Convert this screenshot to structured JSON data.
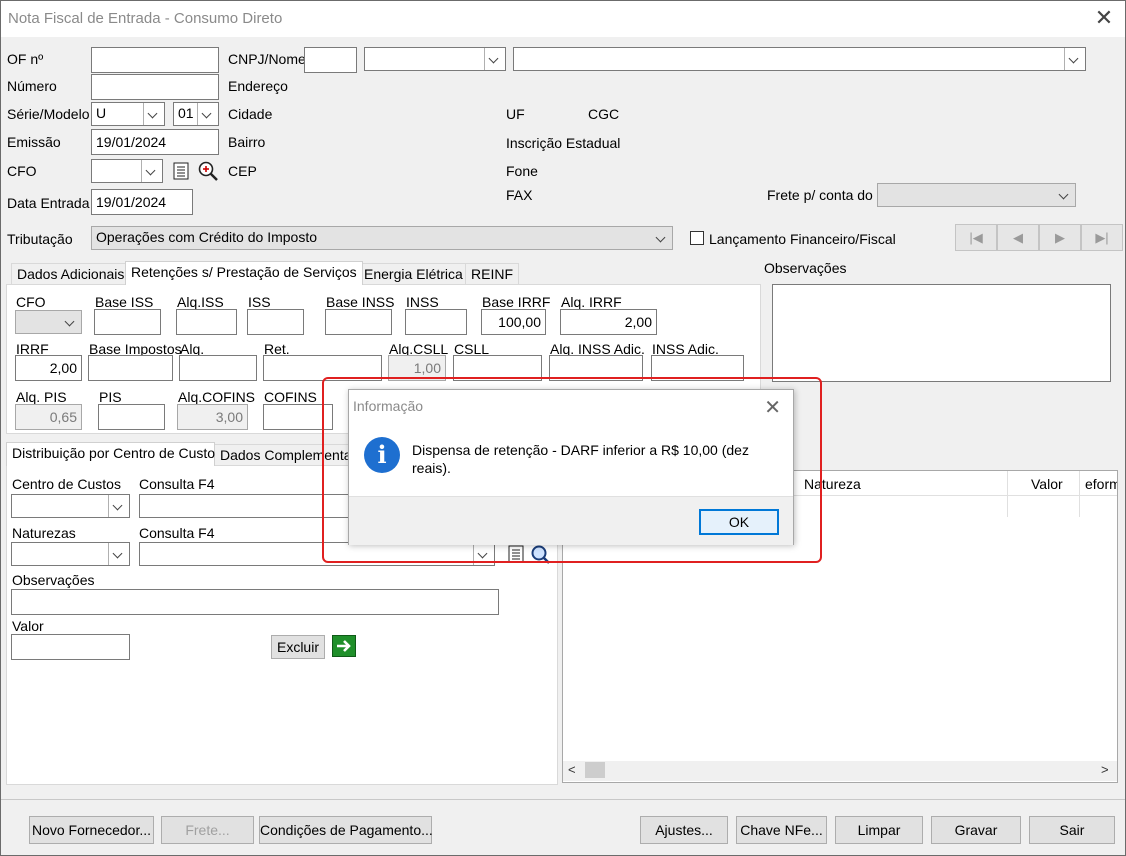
{
  "window": {
    "title": "Nota Fiscal de Entrada - Consumo Direto",
    "close_glyph": "✕"
  },
  "header": {
    "of_label": "OF nº",
    "of_value": "",
    "numero_label": "Número",
    "numero_value": "",
    "serie_label": "Série/Modelo",
    "serie_value": "U",
    "modelo_value": "01",
    "emissao_label": "Emissão",
    "emissao_value": "19/01/2024",
    "cfo_label": "CFO",
    "cfo_value": "",
    "data_entrada_label": "Data Entrada",
    "data_entrada_value": "19/01/2024",
    "cnpj_label": "CNPJ/Nome",
    "endereco_label": "Endereço",
    "cidade_label": "Cidade",
    "bairro_label": "Bairro",
    "cep_label": "CEP",
    "uf_label": "UF",
    "cgc_label": "CGC",
    "inscricao_label": "Inscrição Estadual",
    "fone_label": "Fone",
    "fax_label": "FAX",
    "frete_label": "Frete p/ conta do",
    "frete_value": "",
    "tributacao_label": "Tributação",
    "tributacao_value": "Operações com Crédito do Imposto",
    "lancamento_label": "Lançamento Financeiro/Fiscal",
    "lancamento_checked": false
  },
  "nav": {
    "first": "|◀",
    "prev": "◀",
    "next": "▶",
    "last": "▶|"
  },
  "tabs_top": [
    {
      "label": "Dados Adicionais",
      "active": false
    },
    {
      "label": "Retenções s/ Prestação de Serviços",
      "active": true
    },
    {
      "label": "Energia Elétrica",
      "active": false
    },
    {
      "label": "REINF",
      "active": false
    }
  ],
  "retencoes": {
    "cfo_label": "CFO",
    "cfo_value": "",
    "base_iss_label": "Base ISS",
    "base_iss_value": "",
    "alq_iss_label": "Alq.ISS",
    "alq_iss_value": "",
    "iss_label": "ISS",
    "iss_value": "",
    "base_inss_label": "Base INSS",
    "base_inss_value": "",
    "inss_label": "INSS",
    "inss_value": "",
    "base_irrf_label": "Base IRRF",
    "base_irrf_value": "100,00",
    "alq_irrf_label": "Alq. IRRF",
    "alq_irrf_value": "2,00",
    "irrf_label": "IRRF",
    "irrf_value": "2,00",
    "base_impostos_label": "Base Impostos",
    "base_impostos_value": "",
    "alq_label": "Alq.",
    "alq_value": "",
    "ret_label": "Ret.",
    "ret_value": "",
    "alq_csll_label": "Alq.CSLL",
    "alq_csll_value": "1,00",
    "csll_label": "CSLL",
    "csll_value": "",
    "alq_inss_adic_label": "Alq. INSS Adic.",
    "alq_inss_adic_value": "",
    "inss_adic_label": "INSS Adic.",
    "inss_adic_value": "",
    "alq_pis_label": "Alq. PIS",
    "alq_pis_value": "0,65",
    "pis_label": "PIS",
    "pis_value": "",
    "alq_cofins_label": "Alq.COFINS",
    "alq_cofins_value": "3,00",
    "cofins_label": "COFINS",
    "cofins_value": ""
  },
  "observacoes": {
    "label": "Observações",
    "value": ""
  },
  "tabs_bottom": [
    {
      "label": "Distribuição por Centro de Custo",
      "active": true
    },
    {
      "label": "Dados Complementares",
      "active": false
    }
  ],
  "distribuicao": {
    "centro_label": "Centro de Custos",
    "consulta1_label": "Consulta F4",
    "naturezas_label": "Naturezas",
    "consulta2_label": "Consulta F4",
    "obs_label": "Observações",
    "valor_label": "Valor",
    "excluir_label": "Excluir"
  },
  "grid": {
    "columns": [
      "Natureza",
      "Valor",
      "eform"
    ]
  },
  "dialog": {
    "title": "Informação",
    "message": "Dispensa de retenção - DARF inferior a R$ 10,00 (dez reais).",
    "ok_label": "OK",
    "icon": "info-icon"
  },
  "footer": {
    "novo_fornecedor": "Novo Fornecedor...",
    "frete": "Frete...",
    "condicoes": "Condições de Pagamento...",
    "ajustes": "Ajustes...",
    "chave_nfe": "Chave NFe...",
    "limpar": "Limpar",
    "gravar": "Gravar",
    "sair": "Sair"
  },
  "colors": {
    "highlight": "#e02020",
    "info_blue": "#1e6fd0",
    "ok_border": "#0078d7",
    "go_green": "#1f8f2a"
  }
}
